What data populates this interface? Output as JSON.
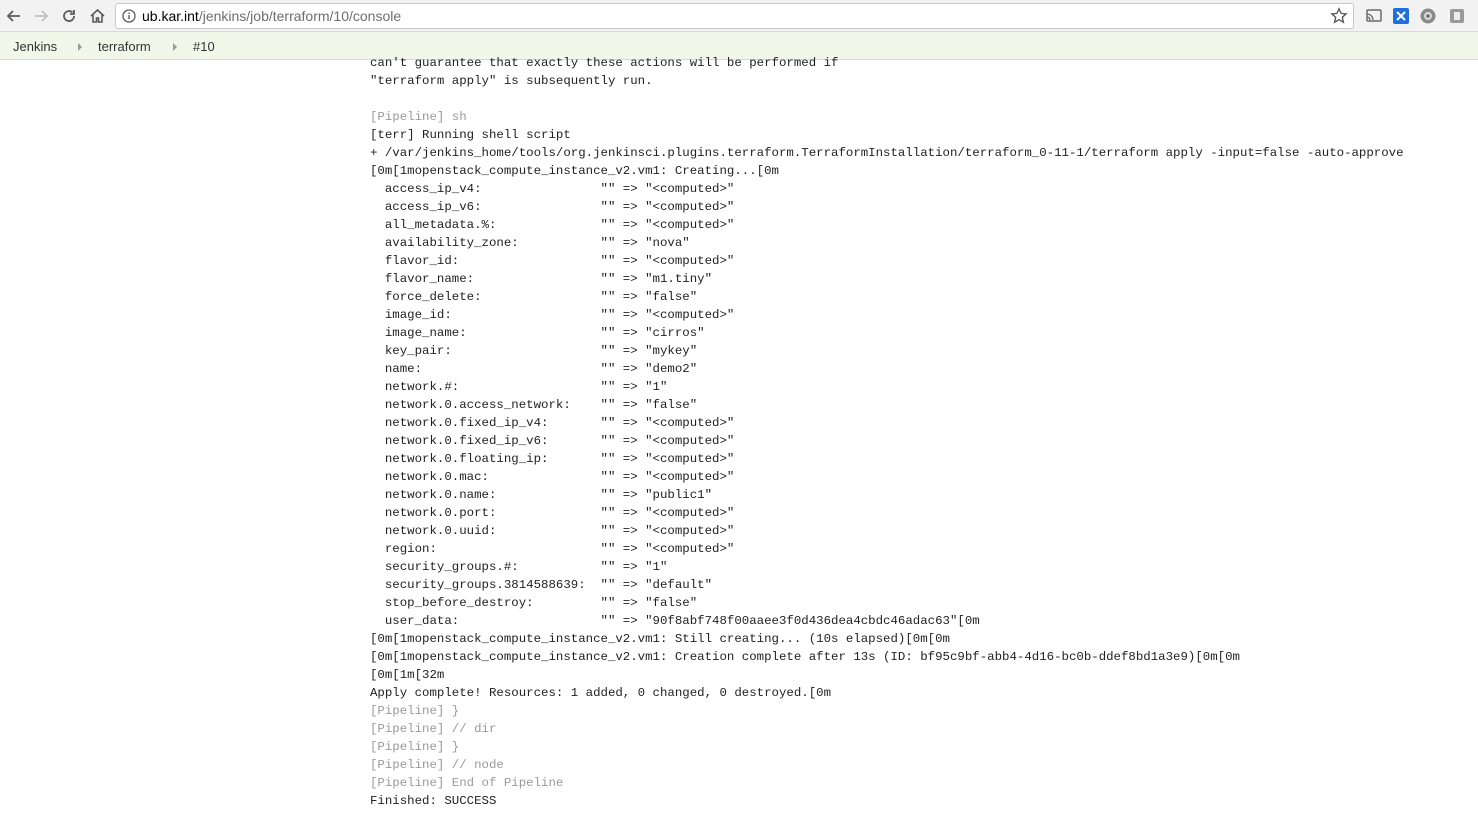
{
  "browser": {
    "url_host": "ub.kar.int",
    "url_path": "/jenkins/job/terraform/10/console"
  },
  "breadcrumbs": [
    {
      "label": "Jenkins"
    },
    {
      "label": "terraform"
    },
    {
      "label": "#10"
    }
  ],
  "console_lines": [
    {
      "text": "can't guarantee that exactly these actions will be performed if",
      "kind": "normal"
    },
    {
      "text": "\"terraform apply\" is subsequently run.",
      "kind": "normal"
    },
    {
      "text": "",
      "kind": "normal"
    },
    {
      "text": "[Pipeline] sh",
      "kind": "pipeline"
    },
    {
      "text": "[terr] Running shell script",
      "kind": "normal"
    },
    {
      "text": "+ /var/jenkins_home/tools/org.jenkinsci.plugins.terraform.TerraformInstallation/terraform_0-11-1/terraform apply -input=false -auto-approve",
      "kind": "normal"
    },
    {
      "text": "[0m[1mopenstack_compute_instance_v2.vm1: Creating...[0m",
      "kind": "normal"
    },
    {
      "text": "  access_ip_v4:                \"\" => \"<computed>\"",
      "kind": "normal"
    },
    {
      "text": "  access_ip_v6:                \"\" => \"<computed>\"",
      "kind": "normal"
    },
    {
      "text": "  all_metadata.%:              \"\" => \"<computed>\"",
      "kind": "normal"
    },
    {
      "text": "  availability_zone:           \"\" => \"nova\"",
      "kind": "normal"
    },
    {
      "text": "  flavor_id:                   \"\" => \"<computed>\"",
      "kind": "normal"
    },
    {
      "text": "  flavor_name:                 \"\" => \"m1.tiny\"",
      "kind": "normal"
    },
    {
      "text": "  force_delete:                \"\" => \"false\"",
      "kind": "normal"
    },
    {
      "text": "  image_id:                    \"\" => \"<computed>\"",
      "kind": "normal"
    },
    {
      "text": "  image_name:                  \"\" => \"cirros\"",
      "kind": "normal"
    },
    {
      "text": "  key_pair:                    \"\" => \"mykey\"",
      "kind": "normal"
    },
    {
      "text": "  name:                        \"\" => \"demo2\"",
      "kind": "normal"
    },
    {
      "text": "  network.#:                   \"\" => \"1\"",
      "kind": "normal"
    },
    {
      "text": "  network.0.access_network:    \"\" => \"false\"",
      "kind": "normal"
    },
    {
      "text": "  network.0.fixed_ip_v4:       \"\" => \"<computed>\"",
      "kind": "normal"
    },
    {
      "text": "  network.0.fixed_ip_v6:       \"\" => \"<computed>\"",
      "kind": "normal"
    },
    {
      "text": "  network.0.floating_ip:       \"\" => \"<computed>\"",
      "kind": "normal"
    },
    {
      "text": "  network.0.mac:               \"\" => \"<computed>\"",
      "kind": "normal"
    },
    {
      "text": "  network.0.name:              \"\" => \"public1\"",
      "kind": "normal"
    },
    {
      "text": "  network.0.port:              \"\" => \"<computed>\"",
      "kind": "normal"
    },
    {
      "text": "  network.0.uuid:              \"\" => \"<computed>\"",
      "kind": "normal"
    },
    {
      "text": "  region:                      \"\" => \"<computed>\"",
      "kind": "normal"
    },
    {
      "text": "  security_groups.#:           \"\" => \"1\"",
      "kind": "normal"
    },
    {
      "text": "  security_groups.3814588639:  \"\" => \"default\"",
      "kind": "normal"
    },
    {
      "text": "  stop_before_destroy:         \"\" => \"false\"",
      "kind": "normal"
    },
    {
      "text": "  user_data:                   \"\" => \"90f8abf748f00aaee3f0d436dea4cbdc46adac63\"[0m",
      "kind": "normal"
    },
    {
      "text": "[0m[1mopenstack_compute_instance_v2.vm1: Still creating... (10s elapsed)[0m[0m",
      "kind": "normal"
    },
    {
      "text": "[0m[1mopenstack_compute_instance_v2.vm1: Creation complete after 13s (ID: bf95c9bf-abb4-4d16-bc0b-ddef8bd1a3e9)[0m[0m",
      "kind": "normal"
    },
    {
      "text": "[0m[1m[32m",
      "kind": "normal"
    },
    {
      "text": "Apply complete! Resources: 1 added, 0 changed, 0 destroyed.[0m",
      "kind": "normal"
    },
    {
      "text": "[Pipeline] }",
      "kind": "pipeline"
    },
    {
      "text": "[Pipeline] // dir",
      "kind": "pipeline"
    },
    {
      "text": "[Pipeline] }",
      "kind": "pipeline"
    },
    {
      "text": "[Pipeline] // node",
      "kind": "pipeline"
    },
    {
      "text": "[Pipeline] End of Pipeline",
      "kind": "pipeline"
    },
    {
      "text": "Finished: SUCCESS",
      "kind": "normal"
    }
  ]
}
